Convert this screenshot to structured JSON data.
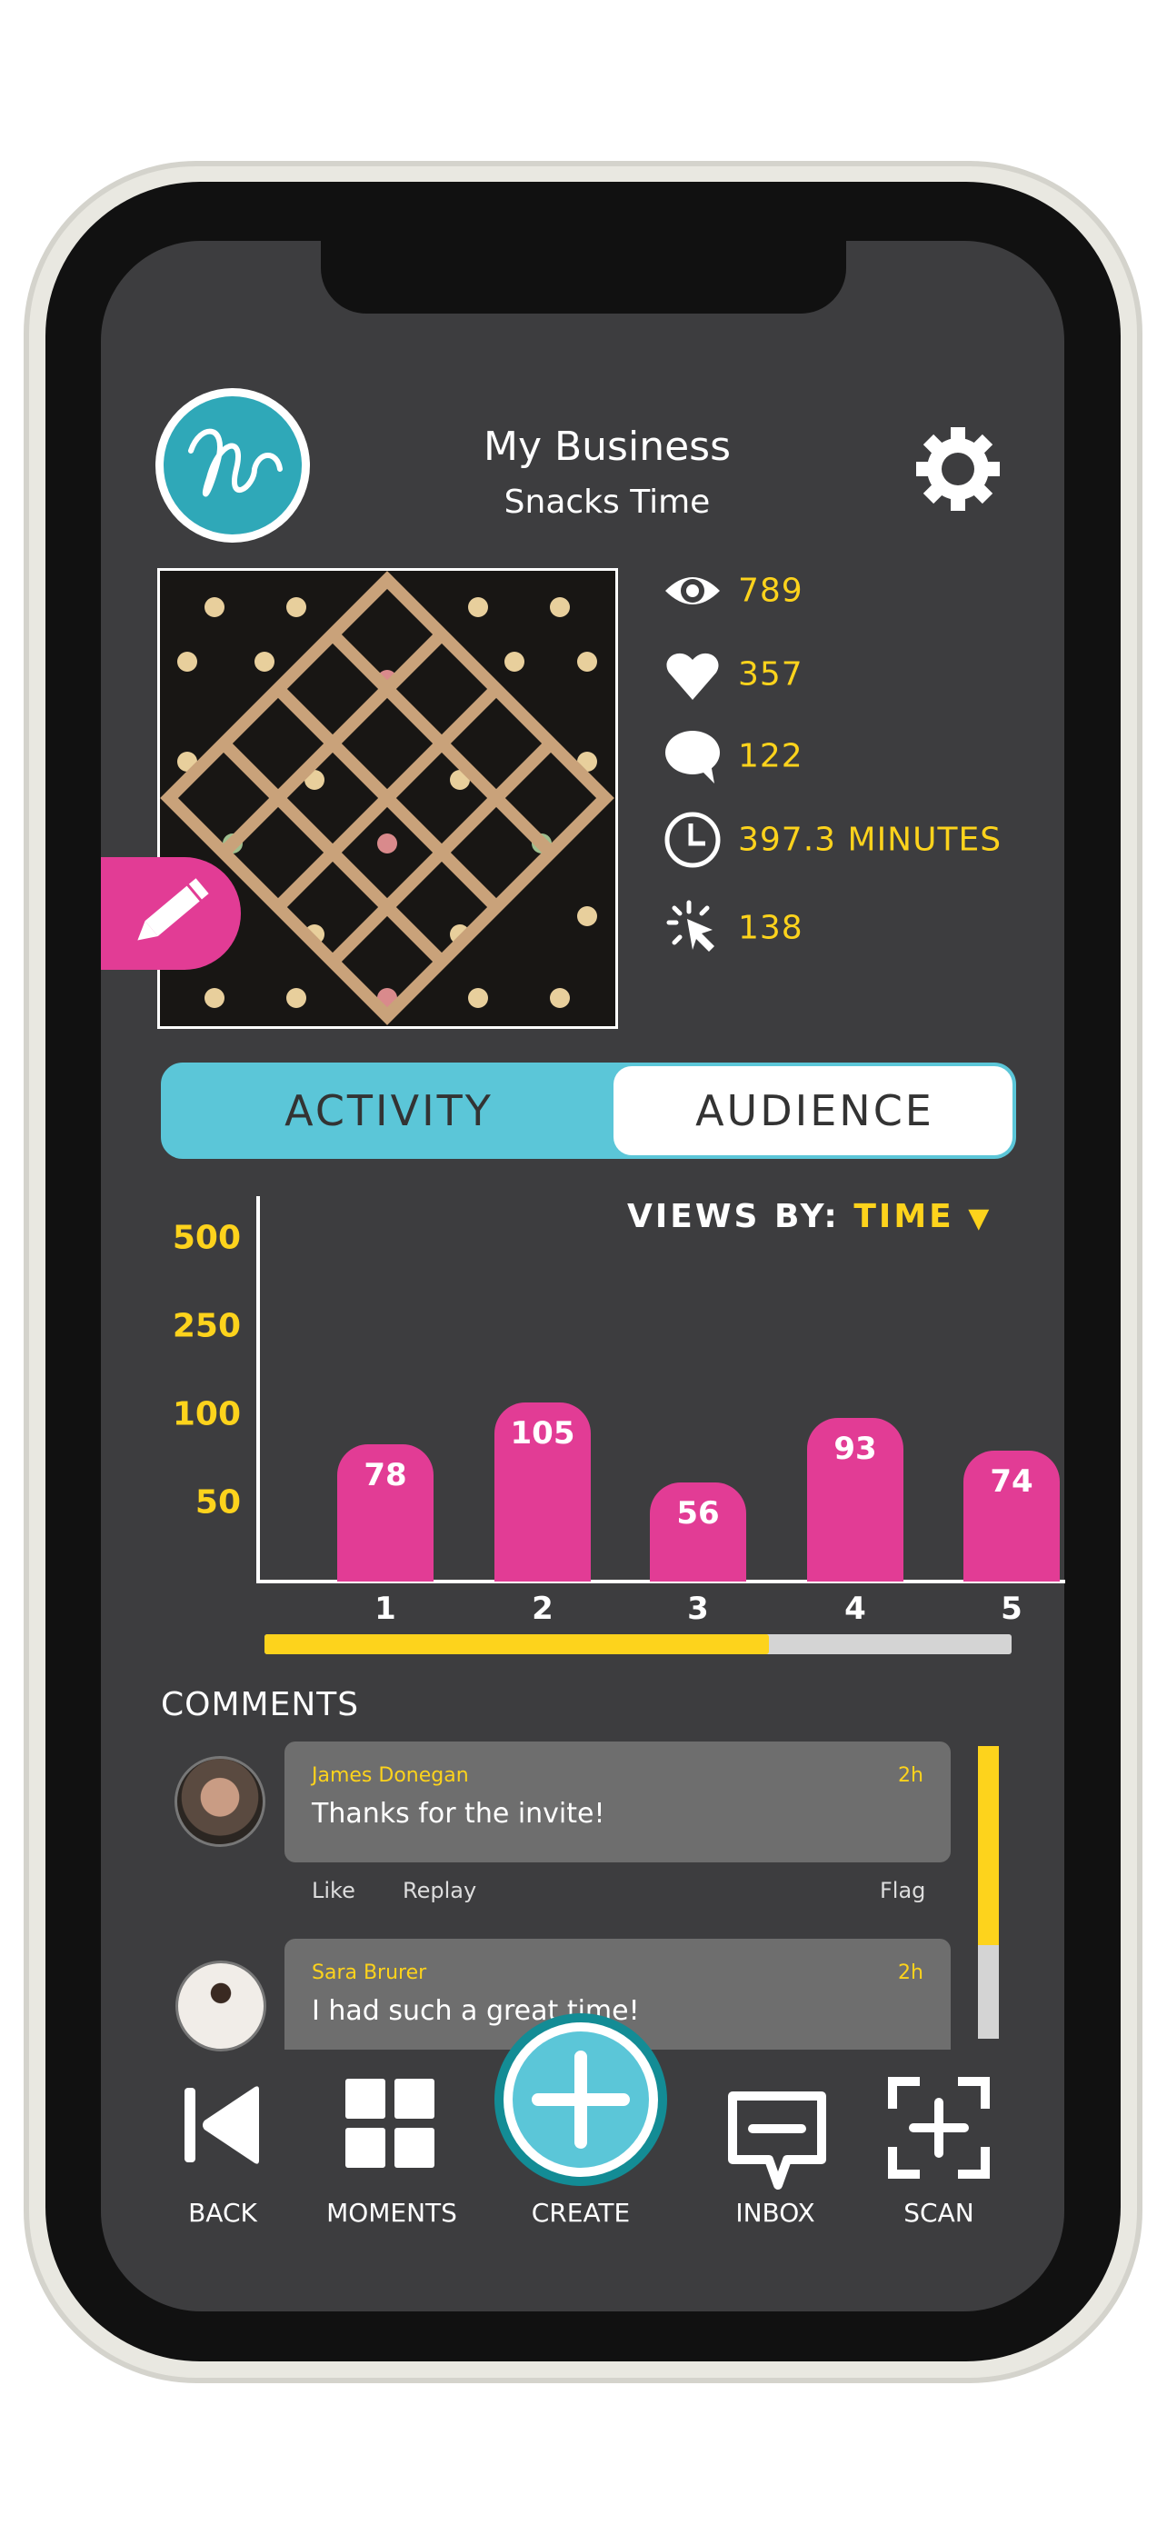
{
  "header": {
    "title": "My Business",
    "subtitle": "Snacks Time",
    "settings_icon": "gear-icon",
    "logo": "script-monogram-logo"
  },
  "stats": [
    {
      "icon": "eye-icon",
      "value": "789"
    },
    {
      "icon": "heart-icon",
      "value": "357"
    },
    {
      "icon": "comment-icon",
      "value": "122"
    },
    {
      "icon": "clock-icon",
      "value": "397.3 MINUTES"
    },
    {
      "icon": "click-icon",
      "value": "138"
    }
  ],
  "tabs": [
    {
      "label": "ACTIVITY",
      "active": true
    },
    {
      "label": "AUDIENCE",
      "active": false
    }
  ],
  "views_by": {
    "label": "VIEWS BY:",
    "value": "TIME"
  },
  "chart_data": {
    "type": "bar",
    "categories": [
      "1",
      "2",
      "3",
      "4",
      "5"
    ],
    "values": [
      78,
      105,
      56,
      93,
      74
    ],
    "yticks": [
      "500",
      "250",
      "100",
      "50"
    ],
    "ytick_values": [
      500,
      250,
      100,
      50
    ],
    "color": "#e23c95"
  },
  "scroll_progress": 0.675,
  "comments_title": "COMMENTS",
  "comments": [
    {
      "name": "James Donegan",
      "time": "2h",
      "text": "Thanks for the invite!",
      "actions": [
        "Like",
        "Replay",
        "Flag"
      ]
    },
    {
      "name": "Sara Brurer",
      "time": "2h",
      "text": "I had such a great time!"
    }
  ],
  "comments_scroll_fraction": 0.68,
  "nav": [
    {
      "label": "BACK"
    },
    {
      "label": "MOMENTS"
    },
    {
      "label": "CREATE"
    },
    {
      "label": "INBOX"
    },
    {
      "label": "SCAN"
    }
  ],
  "colors": {
    "accent": "#5bc6d8",
    "pink": "#e23c95",
    "yellow": "#fdd31c",
    "bg": "#3d3d3f"
  }
}
